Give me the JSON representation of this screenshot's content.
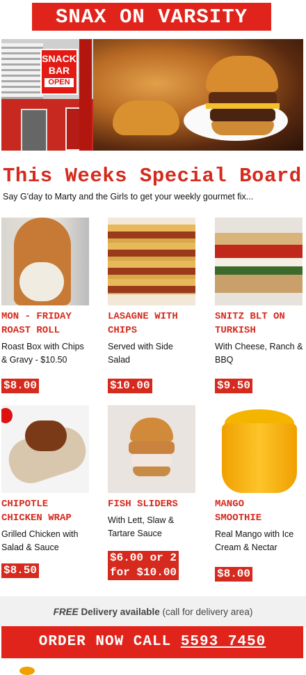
{
  "header": {
    "title": "SNAX ON VARSITY"
  },
  "hero": {
    "sign_line1": "SNACK",
    "sign_line2": "BAR",
    "sign_open": "OPEN",
    "pole_text": "SNACK BAR"
  },
  "specials": {
    "heading": "This Weeks Special Board",
    "intro": "Say G'day to Marty and the Girls to get your weekly gourmet fix..."
  },
  "items": [
    {
      "name1": "MON - FRIDAY",
      "name2": "ROAST ROLL",
      "desc": "Roast Box with Chips & Gravy - $10.50",
      "price": "$8.00"
    },
    {
      "name1": "LASAGNE WITH",
      "name2": "CHIPS",
      "desc": "Served with Side Salad",
      "price": "$10.00"
    },
    {
      "name1": "SNITZ BLT ON",
      "name2": "TURKISH",
      "desc": "With Cheese, Ranch & BBQ",
      "price": "$9.50"
    },
    {
      "name1": "CHIPOTLE",
      "name2": "CHICKEN WRAP",
      "desc": "Grilled Chicken with Salad & Sauce",
      "price": "$8.50"
    },
    {
      "name1": "FISH SLIDERS",
      "name2": "",
      "desc": "With Lett, Slaw & Tartare Sauce",
      "price_line1": "$6.00 or 2",
      "price_line2": "for $10.00"
    },
    {
      "name1": "MANGO",
      "name2": "SMOOTHIE",
      "desc": "Real Mango with Ice Cream & Nectar",
      "price": "$8.00"
    }
  ],
  "delivery": {
    "free": "FREE",
    "main": "Delivery available",
    "note": "(call for delivery area)"
  },
  "order": {
    "label": "ORDER NOW CALL",
    "phone": "5593 7450"
  },
  "colors": {
    "accent": "#d52a1d",
    "banner": "#e0241b"
  }
}
